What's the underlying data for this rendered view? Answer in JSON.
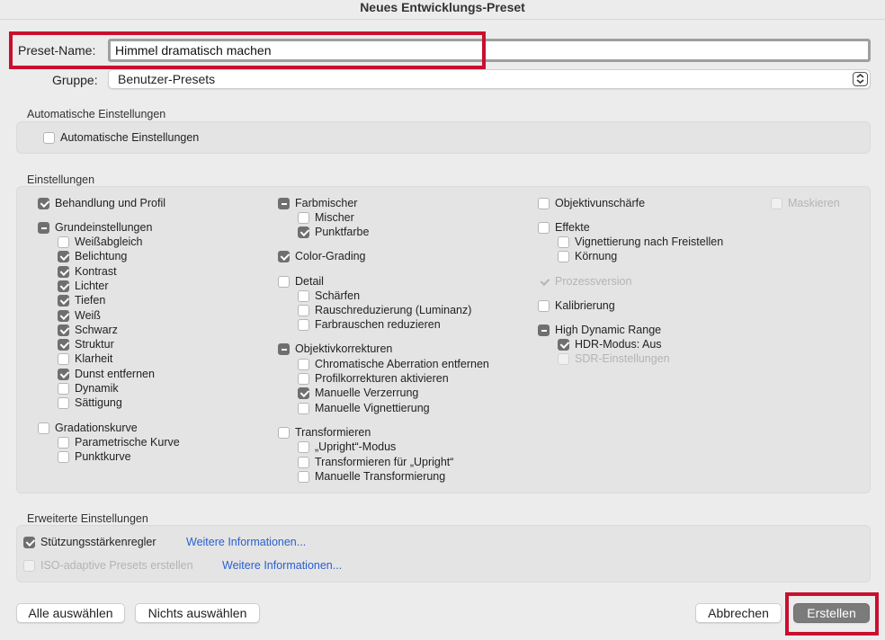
{
  "window": {
    "title": "Neues Entwicklungs-Preset"
  },
  "preset_name": {
    "label": "Preset-Name:",
    "value": "Himmel dramatisch machen"
  },
  "group": {
    "label": "Gruppe:",
    "value": "Benutzer-Presets"
  },
  "auto_section": {
    "title": "Automatische Einstellungen",
    "checkbox": "Automatische Einstellungen"
  },
  "settings": {
    "title": "Einstellungen",
    "col1": {
      "behandlung": "Behandlung und Profil",
      "grund": "Grundeinstellungen",
      "weissabgleich": "Weißabgleich",
      "belichtung": "Belichtung",
      "kontrast": "Kontrast",
      "lichter": "Lichter",
      "tiefen": "Tiefen",
      "weiss": "Weiß",
      "schwarz": "Schwarz",
      "struktur": "Struktur",
      "klarheit": "Klarheit",
      "dunst": "Dunst entfernen",
      "dynamik": "Dynamik",
      "saettigung": "Sättigung",
      "gradation": "Gradationskurve",
      "parametrisch": "Parametrische Kurve",
      "punktkurve": "Punktkurve"
    },
    "col2": {
      "farbmischer": "Farbmischer",
      "mischer": "Mischer",
      "punktfarbe": "Punktfarbe",
      "color_grading": "Color-Grading",
      "detail": "Detail",
      "schaerfen": "Schärfen",
      "rausch": "Rauschreduzierung (Luminanz)",
      "farbrauschen": "Farbrauschen reduzieren",
      "objektiv": "Objektivkorrekturen",
      "chromatisch": "Chromatische Aberration entfernen",
      "profil": "Profilkorrekturen aktivieren",
      "verzerrung": "Manuelle Verzerrung",
      "vignettierung": "Manuelle Vignettierung",
      "transformieren": "Transformieren",
      "upright_modus": "„Upright“-Modus",
      "transform_upright": "Transformieren für „Upright“",
      "manuelle_transform": "Manuelle Transformierung"
    },
    "col3": {
      "objektivunschaerfe": "Objektivunschärfe",
      "effekte": "Effekte",
      "vignettierung_frei": "Vignettierung nach Freistellen",
      "koernung": "Körnung",
      "prozessversion": "Prozessversion",
      "kalibrierung": "Kalibrierung",
      "hdr": "High Dynamic Range",
      "hdr_modus": "HDR-Modus: Aus",
      "sdr": "SDR-Einstellungen"
    },
    "col4": {
      "maskieren": "Maskieren"
    }
  },
  "advanced": {
    "title": "Erweiterte Einstellungen",
    "stuetz": "Stützungsstärkenregler",
    "stuetz_link": "Weitere Informationen...",
    "iso": "ISO-adaptive Presets erstellen",
    "iso_link": "Weitere Informationen..."
  },
  "buttons": {
    "select_all": "Alle auswählen",
    "select_none": "Nichts auswählen",
    "cancel": "Abbrechen",
    "create": "Erstellen"
  },
  "colors": {
    "highlight": "#c8102e",
    "link": "#2a5fd0",
    "primary_button": "#7b7b7b"
  }
}
